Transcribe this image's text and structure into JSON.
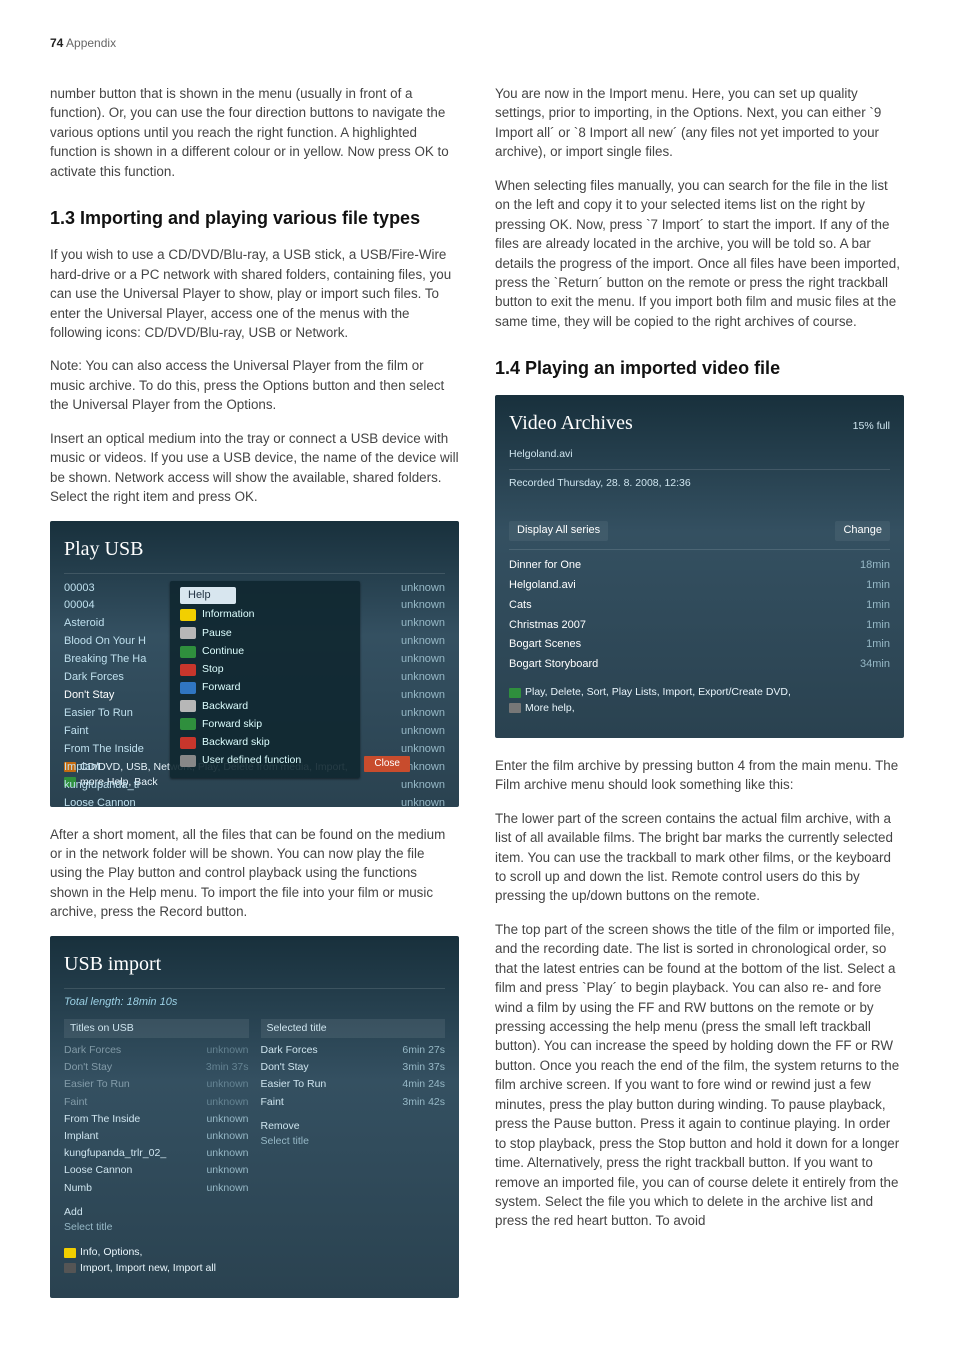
{
  "page": {
    "number": "74",
    "section": "Appendix"
  },
  "col1": {
    "p_intro": "number button that is shown in the menu (usually in front of a function). Or, you can use the four direction buttons to navigate the various options until you reach the right function. A highlighted function is shown in a different colour or in yellow. Now press OK to activate this function.",
    "h_13": "1.3 Importing and playing various file types",
    "p_13a": "If you wish to use a CD/DVD/Blu-ray, a USB stick, a USB/Fire-Wire hard-drive or a PC network with shared folders, containing files, you can use the Universal Player to show, play or import such files. To enter the Universal Player, access one of the menus with the following icons: CD/DVD/Blu-ray, USB or Network.",
    "p_13b": "Note: You can also access the Universal Player from the film or music archive. To do this, press the Options button and then select the Universal Player from the Options.",
    "p_13c": "Insert an optical medium into the tray or connect a USB device with music or videos. If you use a USB device, the name of the device will be shown. Network access will show the available, shared folders. Select the right item and press OK.",
    "p_13d": "After a short moment, all the files that can be found on the medium or in the network folder will be shown. You can now play the file using the Play button and control playback using the functions shown in the Help menu. To import the file into your film or music archive, press the Record button."
  },
  "col2": {
    "p_top": "You are now in the Import menu. Here, you can set up quality settings, prior to importing, in the Options. Next, you can either `9 Import all´ or `8 Import all new´ (any files not yet imported to your archive), or import single files.",
    "p_top2": "When selecting files manually, you can search for the file in the list on the left and copy it to your selected items list on the right by pressing OK. Now, press `7 Import´ to start the import. If any of the files are already located in the archive, you will be told so. A bar details the progress of the import. Once all files have been imported, press the `Return´ button on the remote or press the right trackball button to exit the menu. If you import both film and music files at the same time, they will be copied to the right archives of course.",
    "h_14": "1.4 Playing an imported video file",
    "p_14a": "Enter the film archive by pressing button 4 from the main menu. The Film archive menu should look something like this:",
    "p_14b": "The lower part of the screen contains the actual film archive, with a list of all available films. The bright bar marks the currently selected item. You can use the trackball to mark other films, or the keyboard to scroll up and down the list. Remote control users do this by pressing the up/down buttons on the remote.",
    "p_14c": "The top part of the screen shows the title of the film or imported file, and the recording date. The list is sorted in chronological order, so that the latest entries can be found at the bottom of the list. Select a film and press `Play´ to begin playback. You can also re- and fore wind a film by using the FF and RW buttons on the remote or by pressing accessing the help menu (press the small left trackball button). You can increase the speed by holding down the FF or RW button. Once you reach the end of the film, the system returns to the film archive screen. If you want to fore wind or rewind just a few minutes, press the play button during winding. To pause playback, press the Pause button. Press it again to continue playing. In order to stop playback, press the Stop button and hold it down for a longer time. Alternatively, press the right trackball button. If you want to remove an imported file, you can of course delete it entirely from the system. Select the file you which to delete in the archive list and press the red heart button. To avoid"
  },
  "play_usb": {
    "title": "Play USB",
    "left": [
      "00003",
      "00004",
      "Asteroid",
      "Blood On Your H",
      "Breaking The Ha",
      "Dark Forces",
      "Don't Stay",
      "Easier To Run",
      "Faint",
      "From The Inside",
      "Implant",
      "kungfupanda_tr",
      "Loose Cannon"
    ],
    "right_label": "unknown",
    "help": {
      "title": "Help",
      "items": [
        {
          "color": "#f2cf00",
          "label": "Information"
        },
        {
          "color": "#b7b7b7",
          "label": "Pause"
        },
        {
          "color": "#2f8f3d",
          "label": "Continue"
        },
        {
          "color": "#c7362c",
          "label": "Stop"
        },
        {
          "color": "#3076c2",
          "label": "Forward"
        },
        {
          "color": "#b7b7b7",
          "label": "Backward"
        },
        {
          "color": "#2f8f3d",
          "label": "Forward skip"
        },
        {
          "color": "#c7362c",
          "label": "Backward skip"
        },
        {
          "color": "#888",
          "label": "User defined function"
        }
      ],
      "close": "Close"
    },
    "legend": "CD/DVD, USB, Network, Play, Delete from media, Import,",
    "legend2": "more Help, Back"
  },
  "usb_import": {
    "title": "USB import",
    "total": "Total length: 18min 10s",
    "left_head": "Titles on USB",
    "right_head": "Selected title",
    "left": [
      {
        "name": "Dark Forces",
        "d": "unknown"
      },
      {
        "name": "Don't Stay",
        "d": "3min 37s"
      },
      {
        "name": "Easier To Run",
        "d": "unknown"
      },
      {
        "name": "Faint",
        "d": "unknown"
      },
      {
        "name": "From The Inside",
        "d": "unknown"
      },
      {
        "name": "Implant",
        "d": "unknown"
      },
      {
        "name": "kungfupanda_trlr_02_",
        "d": "unknown"
      },
      {
        "name": "Loose Cannon",
        "d": "unknown"
      },
      {
        "name": "Numb",
        "d": "unknown"
      }
    ],
    "right": [
      {
        "name": "Dark Forces",
        "d": "6min 27s"
      },
      {
        "name": "Don't Stay",
        "d": "3min 37s"
      },
      {
        "name": "Easier To Run",
        "d": "4min 24s"
      },
      {
        "name": "Faint",
        "d": "3min 42s"
      }
    ],
    "add": "Add",
    "select": "Select title",
    "remove": "Remove",
    "legend": "Info, Options,",
    "legend2": "Import, Import new, Import all"
  },
  "video_arch": {
    "title": "Video Archives",
    "full": "15% full",
    "file": "Helgoland.avi",
    "rec": "Recorded Thursday, 28. 8. 2008, 12:36",
    "disp": "Display  All series",
    "change": "Change",
    "rows": [
      {
        "name": "Dinner for One",
        "d": "18min"
      },
      {
        "name": "Helgoland.avi",
        "d": "1min"
      },
      {
        "name": "Cats",
        "d": "1min"
      },
      {
        "name": "Christmas 2007",
        "d": "1min"
      },
      {
        "name": "Bogart Scenes",
        "d": "1min"
      },
      {
        "name": "Bogart Storyboard",
        "d": "34min"
      }
    ],
    "legend": "Play, Delete, Sort, Play Lists, Import, Export/Create DVD,",
    "legend2": "More help,"
  }
}
